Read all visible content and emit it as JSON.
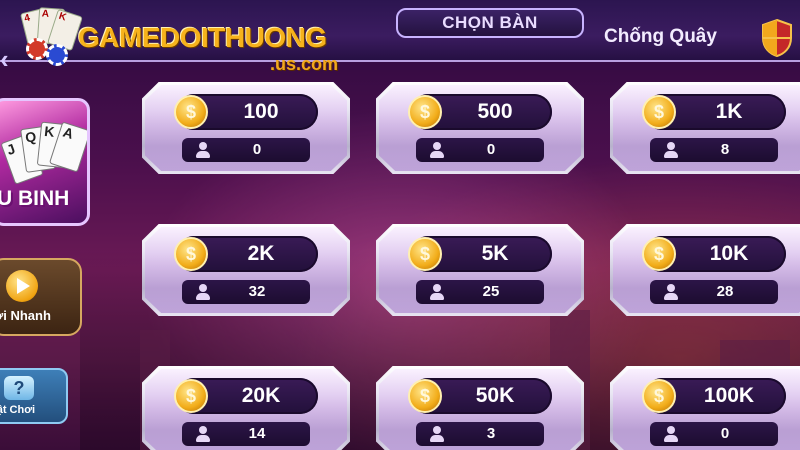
{
  "header": {
    "logo_text": "GAMEDOITHUONG",
    "logo_subtext": ".us.com",
    "title": "CHỌN BÀN",
    "anti_cheat_label": "Chống Quây"
  },
  "sidebar": {
    "game_card_label": "U BINH",
    "quick_play_label": "ơi Nhanh",
    "rules_label": "uật Chơi"
  },
  "tables": [
    {
      "bet": "100",
      "players": "0"
    },
    {
      "bet": "500",
      "players": "0"
    },
    {
      "bet": "1K",
      "players": "8"
    },
    {
      "bet": "2K",
      "players": "32"
    },
    {
      "bet": "5K",
      "players": "25"
    },
    {
      "bet": "10K",
      "players": "28"
    },
    {
      "bet": "20K",
      "players": "14"
    },
    {
      "bet": "50K",
      "players": "3"
    },
    {
      "bet": "100K",
      "players": "0"
    }
  ],
  "icons": {
    "back": "chevron-left-icon",
    "shield": "shield-icon",
    "coin": "coin-icon",
    "person": "person-icon",
    "play": "play-icon",
    "help": "help-icon"
  },
  "colors": {
    "accent_gold": "#f6b21c",
    "panel_purple": "#3b1c60",
    "bet_pill": "#22103a"
  }
}
